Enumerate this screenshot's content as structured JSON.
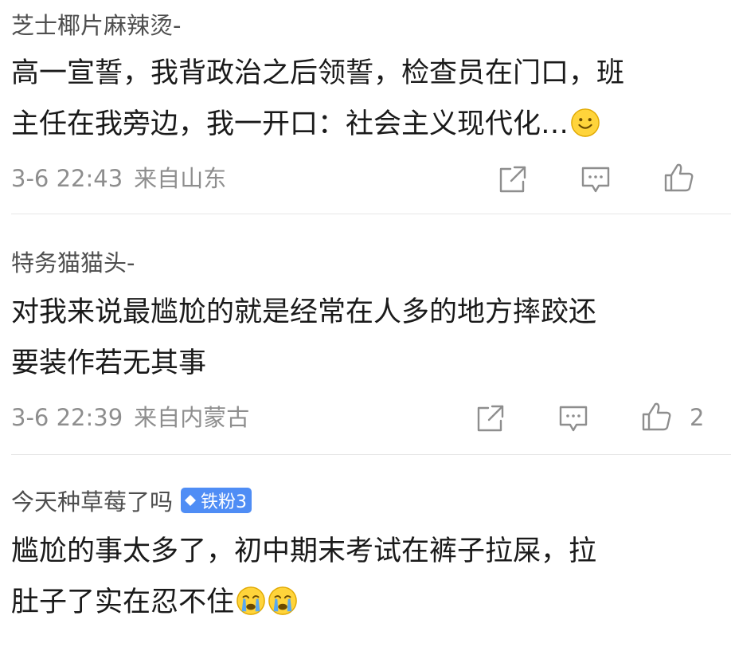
{
  "comments": [
    {
      "username": "芝士椰片麻辣烫-",
      "content_lines": [
        "高一宣誓，我背政治之后领誓，检查员在门口，班",
        "主任在我旁边，我一开口：社会主义现代化…"
      ],
      "emoji": "smile-emoji",
      "date": "3-6 22:43",
      "source_prefix": "来自",
      "location": "山东",
      "like_count": ""
    },
    {
      "username": "特务猫猫头-",
      "content_lines": [
        "对我来说最尴尬的就是经常在人多的地方摔跤还",
        "要装作若无其事"
      ],
      "date": "3-6 22:39",
      "source_prefix": "来自",
      "location": "内蒙古",
      "like_count": "2"
    },
    {
      "username": "今天种草莓了吗",
      "badge": "铁粉3",
      "badge_color": "#4f8df5",
      "content_lines": [
        "尴尬的事太多了，初中期末考试在裤子拉屎，拉",
        "肚子了实在忍不住"
      ],
      "emoji": "crying-emoji"
    }
  ],
  "colors": {
    "text_primary": "#1a1a1a",
    "text_secondary": "#8e8e8e",
    "username": "#4e4e4e",
    "divider": "#e6e6e6",
    "emoji_yellow": "#ffd43b"
  },
  "icons": [
    "share-icon",
    "comment-icon",
    "like-icon"
  ]
}
